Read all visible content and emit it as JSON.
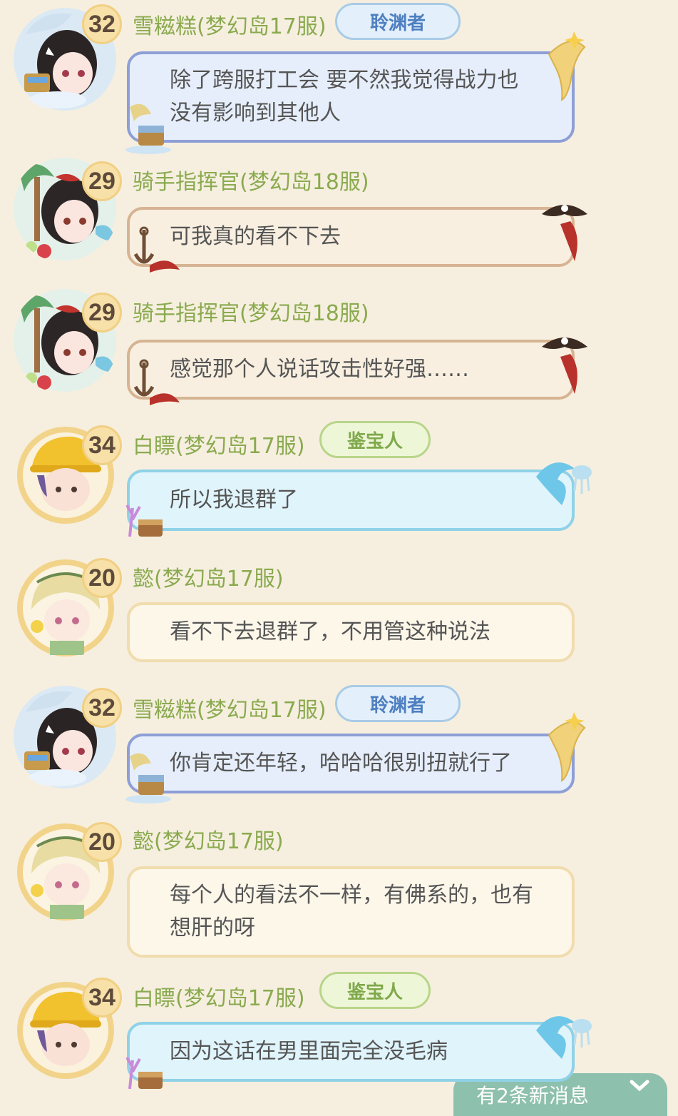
{
  "messages": [
    {
      "level": "32",
      "name": "雪糍糕(梦幻岛17服)",
      "badge": "聆渊者",
      "badge_type": "abyss",
      "lines": [
        "除了跨服打工会 要不然我觉得战力也",
        "没有影响到其他人"
      ],
      "bubble": "blue",
      "avatar": "girl-black"
    },
    {
      "level": "29",
      "name": "骑手指挥官(梦幻岛18服)",
      "badge": "",
      "badge_type": "",
      "lines": [
        "可我真的看不下去"
      ],
      "bubble": "pirate",
      "avatar": "girl-island"
    },
    {
      "level": "29",
      "name": "骑手指挥官(梦幻岛18服)",
      "badge": "",
      "badge_type": "",
      "lines": [
        "感觉那个人说话攻击性好强……"
      ],
      "bubble": "pirate",
      "avatar": "girl-island"
    },
    {
      "level": "34",
      "name": "白瞟(梦幻岛17服)",
      "badge": "鉴宝人",
      "badge_type": "treasure",
      "lines": [
        "所以我退群了"
      ],
      "bubble": "cyan",
      "avatar": "boy-helmet"
    },
    {
      "level": "20",
      "name": "懿(梦幻岛17服)",
      "badge": "",
      "badge_type": "",
      "lines": [
        "看不下去退群了，不用管这种说法"
      ],
      "bubble": "cream",
      "avatar": "girl-blonde"
    },
    {
      "level": "32",
      "name": "雪糍糕(梦幻岛17服)",
      "badge": "聆渊者",
      "badge_type": "abyss",
      "lines": [
        "你肯定还年轻，哈哈哈很别扭就行了"
      ],
      "bubble": "blue",
      "avatar": "girl-black"
    },
    {
      "level": "20",
      "name": "懿(梦幻岛17服)",
      "badge": "",
      "badge_type": "",
      "lines": [
        "每个人的看法不一样，有佛系的，也有",
        "想肝的呀"
      ],
      "bubble": "cream",
      "avatar": "girl-blonde"
    },
    {
      "level": "34",
      "name": "白瞟(梦幻岛17服)",
      "badge": "鉴宝人",
      "badge_type": "treasure",
      "lines": [
        "因为这话在男里面完全没毛病"
      ],
      "bubble": "cyan",
      "avatar": "boy-helmet"
    }
  ],
  "new_messages_toast": "有2条新消息",
  "toast_icon": "chevron-down-icon",
  "colors": {
    "background": "#f6efdf",
    "name": "#8aaa4f",
    "text": "#555555"
  }
}
